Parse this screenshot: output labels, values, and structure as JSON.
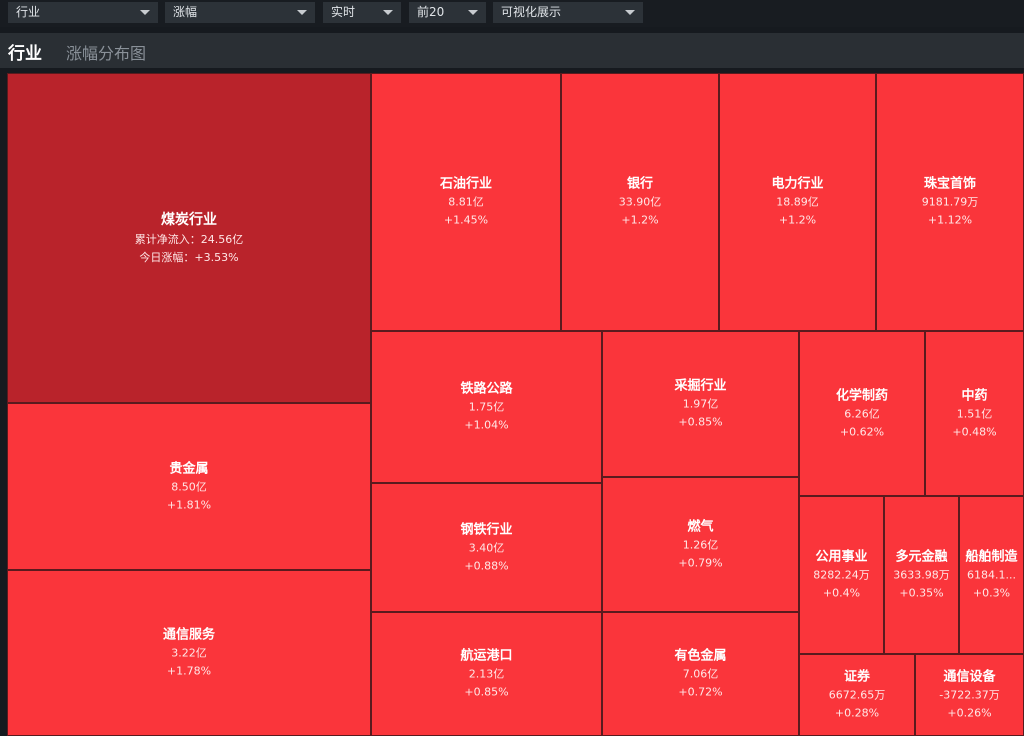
{
  "filters": {
    "category": "行业",
    "metric": "涨幅",
    "period": "实时",
    "topn": "前20",
    "view": "可视化展示"
  },
  "header": {
    "title": "行业",
    "subtitle": "涨幅分布图"
  },
  "colors": {
    "leader_tile": "#b9232b",
    "tile": "#fa353b",
    "border": "#5a1a1e"
  },
  "sectors": [
    {
      "name": "煤炭行业",
      "flow": "累计净流入：24.56亿",
      "change": "今日涨幅：+3.53%"
    },
    {
      "name": "石油行业",
      "flow": "8.81亿",
      "change": "+1.45%"
    },
    {
      "name": "银行",
      "flow": "33.90亿",
      "change": "+1.2%"
    },
    {
      "name": "电力行业",
      "flow": "18.89亿",
      "change": "+1.2%"
    },
    {
      "name": "珠宝首饰",
      "flow": "9181.79万",
      "change": "+1.12%"
    },
    {
      "name": "贵金属",
      "flow": "8.50亿",
      "change": "+1.81%"
    },
    {
      "name": "通信服务",
      "flow": "3.22亿",
      "change": "+1.78%"
    },
    {
      "name": "铁路公路",
      "flow": "1.75亿",
      "change": "+1.04%"
    },
    {
      "name": "采掘行业",
      "flow": "1.97亿",
      "change": "+0.85%"
    },
    {
      "name": "化学制药",
      "flow": "6.26亿",
      "change": "+0.62%"
    },
    {
      "name": "中药",
      "flow": "1.51亿",
      "change": "+0.48%"
    },
    {
      "name": "钢铁行业",
      "flow": "3.40亿",
      "change": "+0.88%"
    },
    {
      "name": "燃气",
      "flow": "1.26亿",
      "change": "+0.79%"
    },
    {
      "name": "航运港口",
      "flow": "2.13亿",
      "change": "+0.85%"
    },
    {
      "name": "有色金属",
      "flow": "7.06亿",
      "change": "+0.72%"
    },
    {
      "name": "公用事业",
      "flow": "8282.24万",
      "change": "+0.4%"
    },
    {
      "name": "多元金融",
      "flow": "3633.98万",
      "change": "+0.35%"
    },
    {
      "name": "船舶制造",
      "flow": "6184.1...",
      "change": "+0.3%"
    },
    {
      "name": "证券",
      "flow": "6672.65万",
      "change": "+0.28%"
    },
    {
      "name": "通信设备",
      "flow": "-3722.37万",
      "change": "+0.26%"
    }
  ]
}
